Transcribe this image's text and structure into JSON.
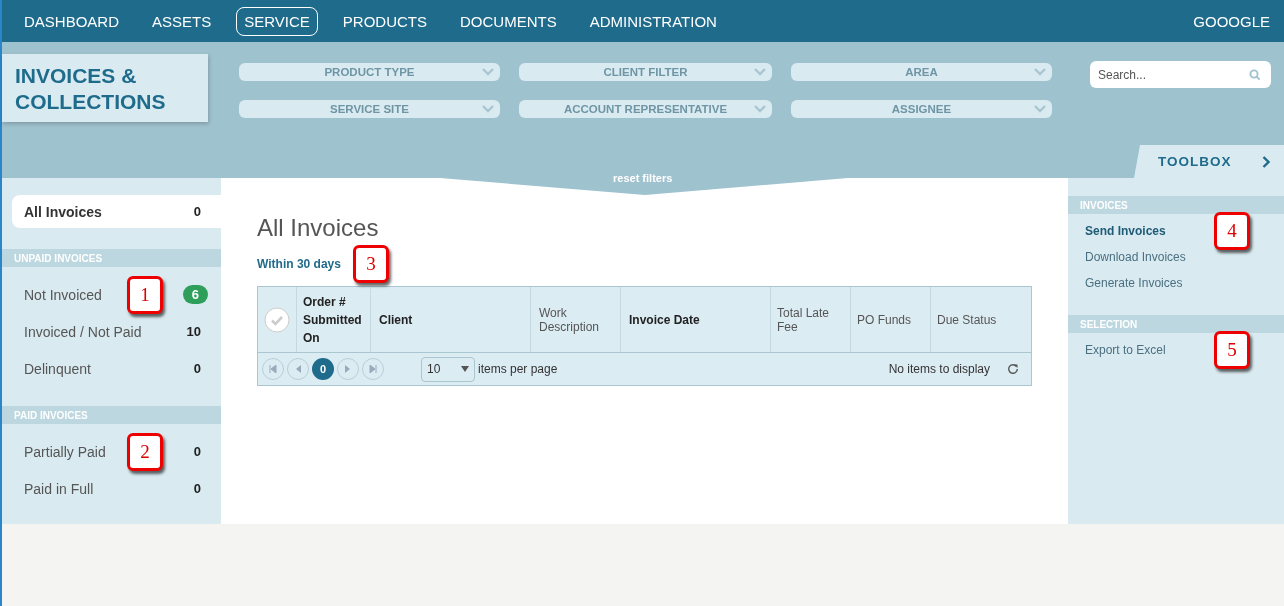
{
  "nav": {
    "items": [
      {
        "label": "DASHBOARD",
        "selected": false
      },
      {
        "label": "ASSETS",
        "selected": false
      },
      {
        "label": "SERVICE",
        "selected": true
      },
      {
        "label": "PRODUCTS",
        "selected": false
      },
      {
        "label": "DOCUMENTS",
        "selected": false
      },
      {
        "label": "ADMINISTRATION",
        "selected": false
      }
    ],
    "user": "GOOOGLE"
  },
  "page_title": "INVOICES & COLLECTIONS",
  "filters": [
    {
      "label": "PRODUCT TYPE"
    },
    {
      "label": "CLIENT FILTER"
    },
    {
      "label": "AREA"
    },
    {
      "label": "SERVICE SITE"
    },
    {
      "label": "ACCOUNT REPRESENTATIVE"
    },
    {
      "label": "ASSIGNEE"
    }
  ],
  "search": {
    "placeholder": "Search..."
  },
  "reset_filters": "reset filters",
  "toolbox_tab": "TOOLBOX",
  "sidebar": {
    "all": {
      "label": "All Invoices",
      "count": "0",
      "selected": true
    },
    "sections": [
      {
        "title": "UNPAID INVOICES",
        "items": [
          {
            "label": "Not Invoiced",
            "count": "6",
            "badge": true,
            "callout": "1"
          },
          {
            "label": "Invoiced / Not Paid",
            "count": "10",
            "badge": false
          },
          {
            "label": "Delinquent",
            "count": "0",
            "badge": false
          }
        ]
      },
      {
        "title": "PAID INVOICES",
        "items": [
          {
            "label": "Partially Paid",
            "count": "0",
            "badge": false,
            "callout": "2"
          },
          {
            "label": "Paid in Full",
            "count": "0",
            "badge": false
          }
        ]
      }
    ]
  },
  "content": {
    "title": "All Invoices",
    "subtitle": "Within 30 days",
    "callout": "3",
    "table": {
      "select_all_checked": false,
      "columns": [
        {
          "label": "Order # Submitted On",
          "emphasized": true
        },
        {
          "label": "Client",
          "emphasized": true
        },
        {
          "label": "Work Description",
          "emphasized": false
        },
        {
          "label": "Invoice Date",
          "emphasized": true
        },
        {
          "label": "Total Late Fee",
          "emphasized": false
        },
        {
          "label": "PO Funds",
          "emphasized": false
        },
        {
          "label": "Due Status",
          "emphasized": false
        }
      ],
      "pager": {
        "pages": [
          {
            "label": "0",
            "selected": true
          }
        ],
        "page_size": "10",
        "page_size_label": "items per page",
        "status": "No items to display"
      }
    }
  },
  "toolbox": {
    "sections": [
      {
        "title": "INVOICES",
        "items": [
          {
            "label": "Send Invoices",
            "selected": true,
            "callout": "4"
          },
          {
            "label": "Download Invoices",
            "selected": false
          },
          {
            "label": "Generate Invoices",
            "selected": false
          }
        ]
      },
      {
        "title": "SELECTION",
        "items": [
          {
            "label": "Export to Excel",
            "selected": false,
            "callout": "5"
          }
        ]
      }
    ]
  }
}
